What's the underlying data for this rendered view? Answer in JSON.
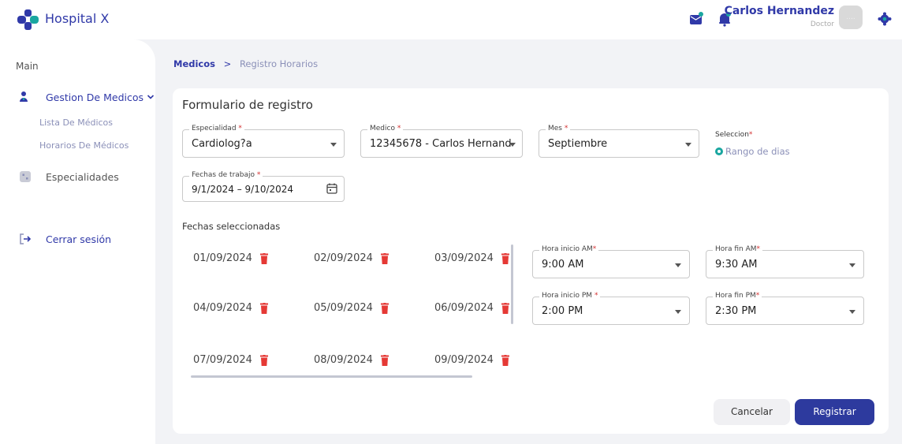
{
  "header": {
    "brand": "Hospital X",
    "user_name": "Carlos Hernandez",
    "user_role": "Doctor",
    "avatar_text": "....",
    "icons": [
      "mail-icon",
      "bell-icon",
      "gear-icon"
    ]
  },
  "sidebar": {
    "section": "Main",
    "group_label": "Gestion De Medicos",
    "sub_items": [
      "Lista De Médicos",
      "Horarios De Médicos"
    ],
    "specialties": "Especialidades",
    "logout": "Cerrar sesión"
  },
  "breadcrumb": {
    "parent": "Medicos",
    "separator": ">",
    "current": "Registro Horarios"
  },
  "form": {
    "title": "Formulario de registro",
    "especialidad": {
      "label": "Especialidad",
      "value": "Cardiolog?a"
    },
    "medico": {
      "label": "Medico",
      "value": "12345678 - Carlos Hernand..."
    },
    "mes": {
      "label": "Mes",
      "value": "Septiembre"
    },
    "seleccion": {
      "label": "Seleccion",
      "option": "Rango de dias"
    },
    "fechas_trabajo": {
      "label": "Fechas de trabajo",
      "value": "9/1/2024 – 9/10/2024"
    },
    "required_mark": "*",
    "selected_title": "Fechas seleccionadas",
    "selected_dates": [
      "01/09/2024",
      "02/09/2024",
      "03/09/2024",
      "04/09/2024",
      "05/09/2024",
      "06/09/2024",
      "07/09/2024",
      "08/09/2024",
      "09/09/2024"
    ],
    "hora_inicio_am": {
      "label": "Hora inicio AM",
      "value": "9:00 AM"
    },
    "hora_fin_am": {
      "label": "Hora fin AM",
      "value": "9:30 AM"
    },
    "hora_inicio_pm": {
      "label": "Hora inicio PM",
      "value": "2:00 PM"
    },
    "hora_fin_pm": {
      "label": "Hora fin PM",
      "value": "2:30 PM"
    },
    "cancel_label": "Cancelar",
    "submit_label": "Registrar"
  },
  "colors": {
    "primary": "#3039a8",
    "button_primary": "#2d3a9e",
    "accent_teal": "#1aa6a0",
    "danger": "#e53935",
    "background": "#f2f3f6"
  }
}
